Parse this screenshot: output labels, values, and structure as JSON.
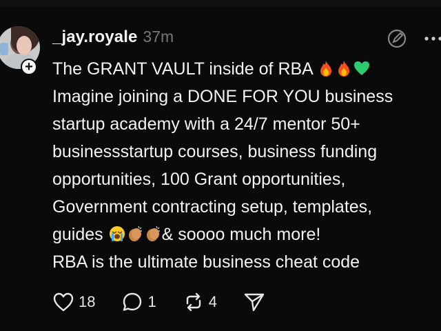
{
  "post": {
    "username": "_jay.royale",
    "timestamp": "37m",
    "text_lines": [
      "The GRANT VAULT inside of RBA",
      "Imagine joining a DONE FOR YOU business",
      "startup academy with a 24/7 mentor 50+",
      "businessstartup courses, business funding",
      "opportunities, 100 Grant opportunities,",
      "Government contracting setup, templates,",
      "guides",
      "& soooo much more!",
      "RBA is the ultimate business cheat code"
    ],
    "emojis": {
      "line1": [
        "fire-icon",
        "fire-icon",
        "green-heart-icon"
      ],
      "line7": [
        "crying-face-icon",
        "clapping-hands-icon",
        "clapping-hands-icon"
      ]
    }
  },
  "actions": {
    "likes": "18",
    "replies": "1",
    "reposts": "4"
  },
  "colors": {
    "background": "#0a0a0a",
    "text": "#f3f3f3",
    "muted": "#777777"
  }
}
